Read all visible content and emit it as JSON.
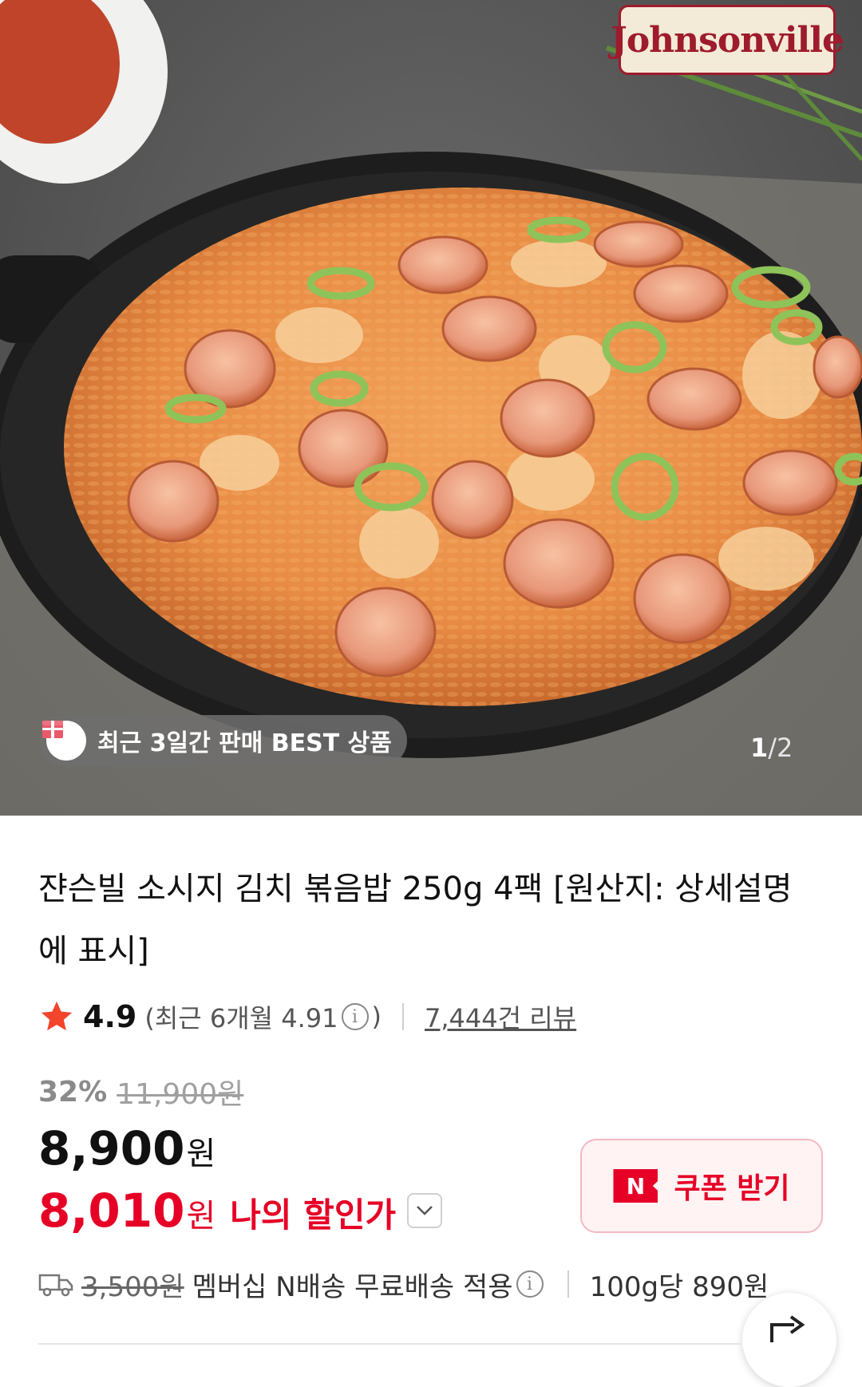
{
  "hero": {
    "brand_logo_text": "Johnsonville",
    "best_badge": "최근 3일간 판매 BEST 상품",
    "pager": {
      "current": "1",
      "separator": "/",
      "total": "2"
    }
  },
  "product": {
    "title": "쟌슨빌 소시지 김치 볶음밥 250g 4팩 [원산지: 상세설명에 표시]",
    "rating": {
      "score": "4.9",
      "recent_prefix": "(최근 6개월 4.91",
      "recent_suffix": ")",
      "review_link": "7,444건 리뷰"
    },
    "price": {
      "discount_rate": "32%",
      "original": "11,900원",
      "sale_value": "8,900",
      "sale_unit": "원",
      "my_value": "8,010",
      "my_unit": "원",
      "my_label": "나의 할인가"
    },
    "coupon": {
      "logo": "N",
      "label": "쿠폰 받기"
    },
    "delivery": {
      "fee": "3,500원",
      "text": "멤버십 N배송 무료배송 적용",
      "unit_price": "100g당 890원"
    }
  },
  "colors": {
    "accent_red": "#e60026",
    "coupon_bg": "#fff3f4",
    "brand_red": "#9e1b2c"
  },
  "icons": [
    "star-icon",
    "info-icon",
    "chevron-down-icon",
    "truck-icon",
    "share-icon",
    "gift-icon"
  ]
}
